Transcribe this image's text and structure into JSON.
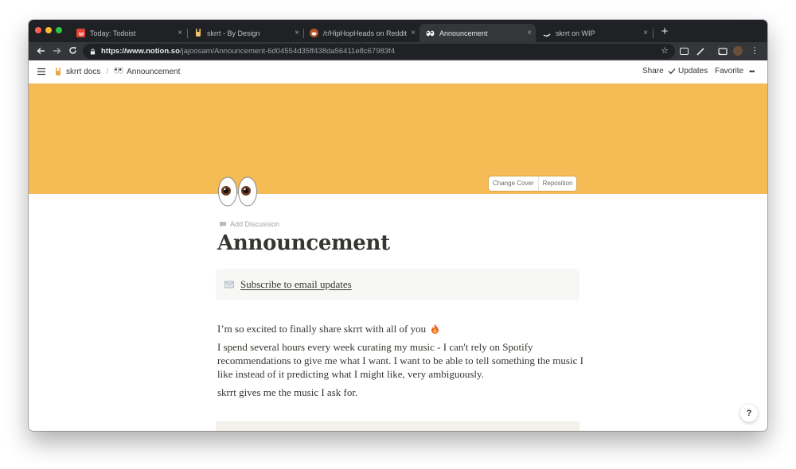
{
  "browser": {
    "tabs": [
      {
        "title": "Today: Todoist",
        "favicon": "todoist-icon",
        "close": "×"
      },
      {
        "title": "skrrt - By Design",
        "favicon": "rock-hand-icon",
        "close": "×"
      },
      {
        "title": "/r/HipHopHeads on Reddit",
        "favicon": "reddit-icon",
        "close": "×"
      },
      {
        "title": "Announcement",
        "favicon": "eyes-icon",
        "close": "×"
      },
      {
        "title": "skrrt on WIP",
        "favicon": "wip-icon",
        "close": "×"
      }
    ],
    "active_tab_index": 3,
    "new_tab_label": "+",
    "url_prefix": "https://",
    "url_host": "www.notion.so",
    "url_path": "/jajoosam/Announcement-6d04554d35ff438da56411e8c67983f4"
  },
  "notion_topbar": {
    "workspace": "skrrt docs",
    "separator": "/",
    "page": "Announcement",
    "share": "Share",
    "updates": "Updates",
    "favorite": "Favorite",
    "more": "•••"
  },
  "cover": {
    "color": "#f5bb55",
    "change_cover": "Change Cover",
    "reposition": "Reposition"
  },
  "page": {
    "add_discussion": "Add Discussion",
    "title": "Announcement",
    "callout_link": "Subscribe to email updates",
    "paragraphs": {
      "p1": "I’m so excited to finally share skrrt with all of you",
      "p2": "I spend several hours every week curating my music - I can't rely on Spotify recommendations to give me what I want. I want to be able to tell something the music I like instead of it predicting what I might like, very ambiguously.",
      "p3": "skrrt gives me the music I ask for."
    }
  },
  "help_button": "?",
  "colors": {
    "tab_strip": "#202124",
    "toolbar": "#35363a",
    "text": "#37352f",
    "muted": "#a5a4a0"
  }
}
